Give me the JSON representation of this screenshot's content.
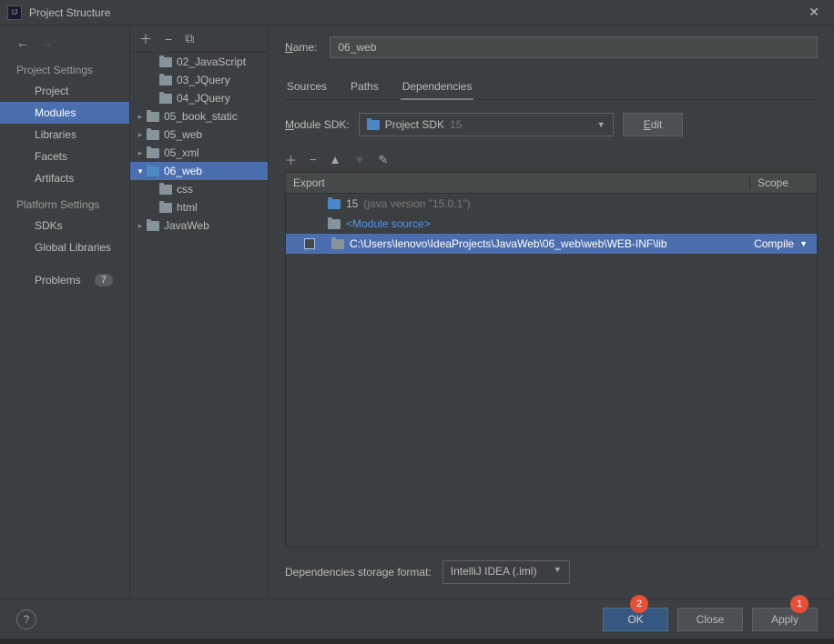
{
  "titlebar": {
    "title": "Project Structure"
  },
  "sidebar": {
    "nav_back": "←",
    "nav_fwd": "→",
    "heading1": "Project Settings",
    "items1": [
      "Project",
      "Modules",
      "Libraries",
      "Facets",
      "Artifacts"
    ],
    "heading2": "Platform Settings",
    "items2": [
      "SDKs",
      "Global Libraries"
    ],
    "problems_label": "Problems",
    "problems_count": "7"
  },
  "tree": {
    "items": [
      {
        "label": "02_JavaScript",
        "indent": 18,
        "chev": ""
      },
      {
        "label": "03_JQuery",
        "indent": 18,
        "chev": ""
      },
      {
        "label": "04_JQuery",
        "indent": 18,
        "chev": ""
      },
      {
        "label": "05_book_static",
        "indent": 4,
        "chev": "▸"
      },
      {
        "label": "05_web",
        "indent": 4,
        "chev": "▸"
      },
      {
        "label": "05_xml",
        "indent": 4,
        "chev": "▸"
      },
      {
        "label": "06_web",
        "indent": 4,
        "chev": "▾",
        "selected": true,
        "blue": true
      },
      {
        "label": "css",
        "indent": 18,
        "chev": ""
      },
      {
        "label": "html",
        "indent": 18,
        "chev": ""
      },
      {
        "label": "JavaWeb",
        "indent": 4,
        "chev": "▸"
      }
    ]
  },
  "detail": {
    "name_label_pre": "N",
    "name_label_rest": "ame:",
    "name_value": "06_web",
    "tabs": [
      "Sources",
      "Paths",
      "Dependencies"
    ],
    "sdk_label_pre": "M",
    "sdk_label_rest": "odule SDK:",
    "sdk_value": "Project SDK",
    "sdk_ver": "15",
    "edit_pre": "E",
    "edit_rest": "dit",
    "dep_header_export": "Export",
    "dep_header_scope": "Scope",
    "dep_rows": [
      {
        "text": "15",
        "extra": "(java version \"15.0.1\")",
        "type": "sdk"
      },
      {
        "text": "<Module source>",
        "type": "src"
      },
      {
        "text": "C:\\Users\\lenovo\\IdeaProjects\\JavaWeb\\06_web\\web\\WEB-INF\\lib",
        "type": "lib",
        "scope": "Compile",
        "selected": true
      }
    ],
    "storage_label": "Dependencies storage format:",
    "storage_value": "IntelliJ IDEA (.iml)"
  },
  "footer": {
    "help": "?",
    "ok": "OK",
    "cancel": "Close",
    "apply": "Apply",
    "badge1": "1",
    "badge2": "2"
  }
}
